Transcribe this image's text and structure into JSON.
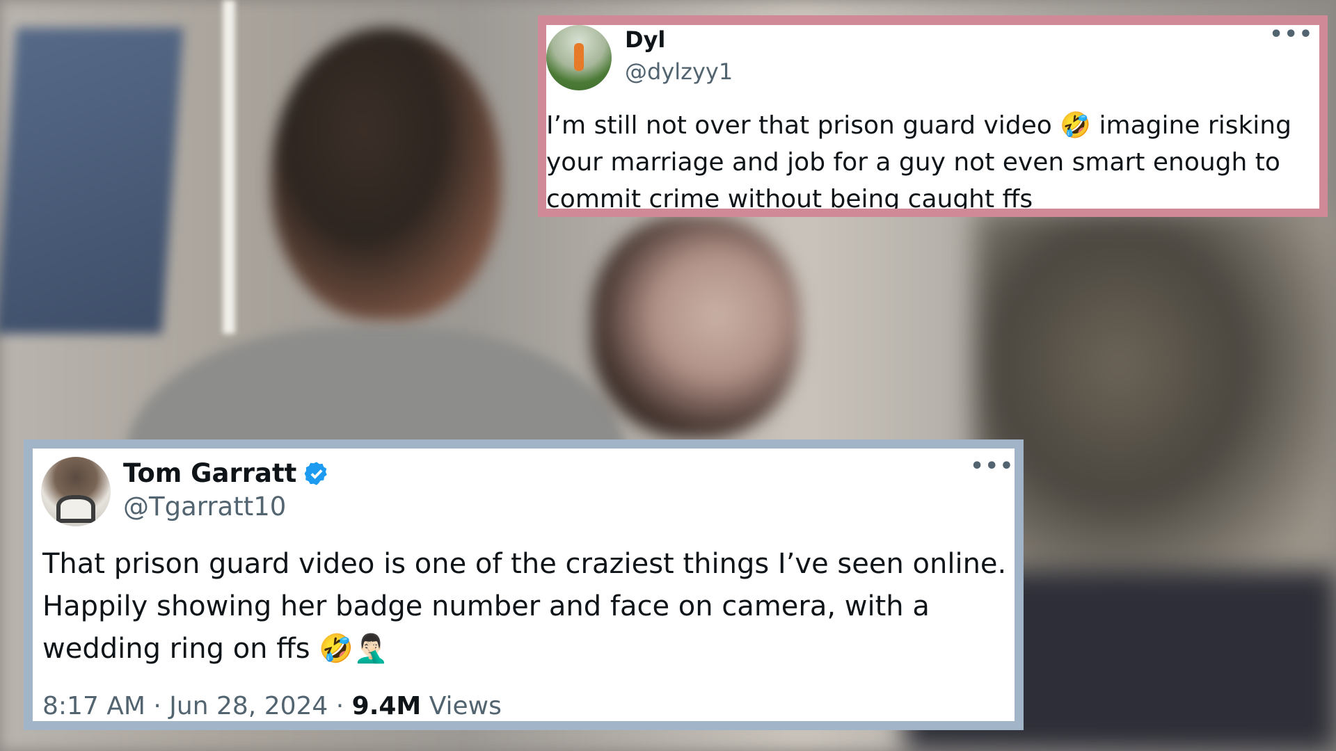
{
  "tweets": [
    {
      "display_name": "Dyl",
      "handle": "@dylzyy1",
      "more_label": "•••",
      "text": "I’m still not over that prison guard video 🤣 imagine risking your marriage and job for a guy not even smart enough to commit crime without being caught ffs",
      "border_color": "#d08997"
    },
    {
      "display_name": "Tom Garratt",
      "verified": true,
      "handle": "@Tgarratt10",
      "more_label": "•••",
      "text": "That prison guard video is one of the craziest things I’ve seen online. Happily showing her badge number and face on camera, with a wedding ring on ffs 🤣🤦🏻‍♂️",
      "timestamp": "8:17 AM · Jun 28, 2024 · ",
      "views_count": "9.4M",
      "views_label": " Views",
      "border_color": "#a2b4c8"
    }
  ],
  "colors": {
    "name": "#0f1419",
    "secondary": "#536471",
    "verified_badge": "#1d9bf0"
  }
}
